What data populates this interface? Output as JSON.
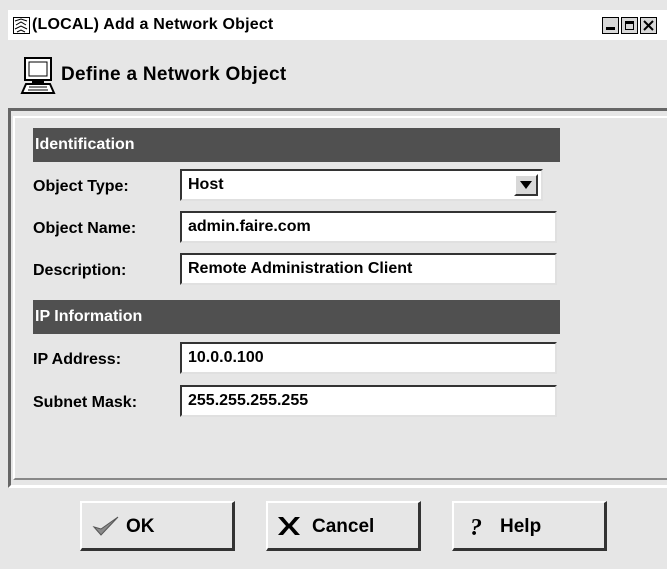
{
  "window": {
    "title": "(LOCAL) Add a Network Object",
    "icon": "network-object-app-icon",
    "controls": [
      "minimize",
      "maximize",
      "close"
    ]
  },
  "header": {
    "icon": "computer-icon",
    "text": "Define a Network Object"
  },
  "sections": {
    "identification": {
      "title": "Identification",
      "object_type": {
        "label": "Object Type:",
        "value": "Host"
      },
      "object_name": {
        "label": "Object Name:",
        "value": "admin.faire.com"
      },
      "description": {
        "label": "Description:",
        "value": "Remote Administration Client"
      }
    },
    "ip_information": {
      "title": "IP Information",
      "ip_address": {
        "label": "IP Address:",
        "value": "10.0.0.100"
      },
      "subnet_mask": {
        "label": "Subnet Mask:",
        "value": "255.255.255.255"
      }
    }
  },
  "buttons": {
    "ok": "OK",
    "cancel": "Cancel",
    "help": "Help"
  }
}
